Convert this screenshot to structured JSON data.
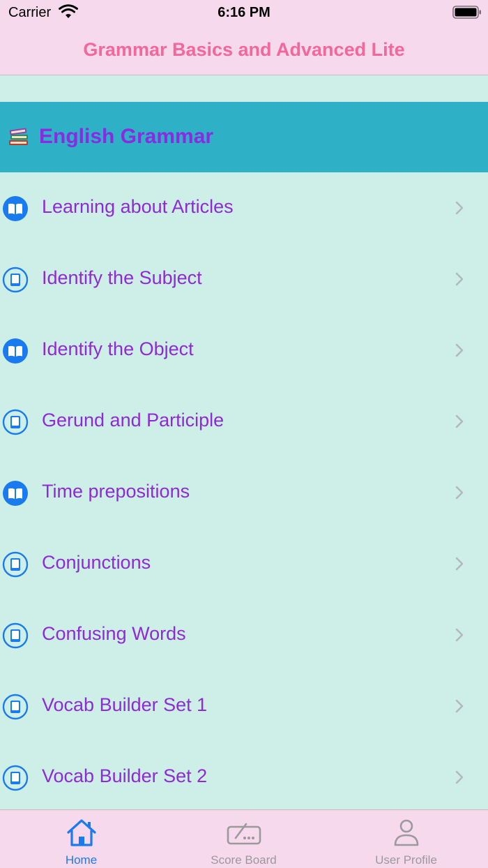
{
  "status_bar": {
    "carrier": "Carrier",
    "time": "6:16 PM"
  },
  "nav": {
    "title": "Grammar Basics and Advanced Lite"
  },
  "section": {
    "icon": "books-icon",
    "title": "English Grammar"
  },
  "items": [
    {
      "label": "Learning about Articles",
      "icon": "book-open-filled-icon"
    },
    {
      "label": "Identify the Subject",
      "icon": "book-closed-outline-icon"
    },
    {
      "label": "Identify the Object",
      "icon": "book-open-filled-icon"
    },
    {
      "label": "Gerund and Participle",
      "icon": "book-closed-outline-icon"
    },
    {
      "label": "Time prepositions",
      "icon": "book-open-filled-icon"
    },
    {
      "label": "Conjunctions",
      "icon": "book-closed-outline-icon"
    },
    {
      "label": "Confusing Words",
      "icon": "book-closed-outline-icon"
    },
    {
      "label": "Vocab Builder Set 1",
      "icon": "book-closed-outline-icon"
    },
    {
      "label": "Vocab Builder Set 2",
      "icon": "book-closed-outline-icon"
    }
  ],
  "tabs": [
    {
      "label": "Home",
      "icon": "home-icon",
      "active": true
    },
    {
      "label": "Score Board",
      "icon": "scoreboard-icon",
      "active": false
    },
    {
      "label": "User Profile",
      "icon": "person-icon",
      "active": false
    }
  ],
  "colors": {
    "bar_background": "#f7d9ee",
    "content_background": "#cdefe8",
    "section_background": "#2eb0c7",
    "title_pink": "#f2679d",
    "label_purple": "#8e2ad6",
    "icon_blue": "#1a7bf0"
  }
}
